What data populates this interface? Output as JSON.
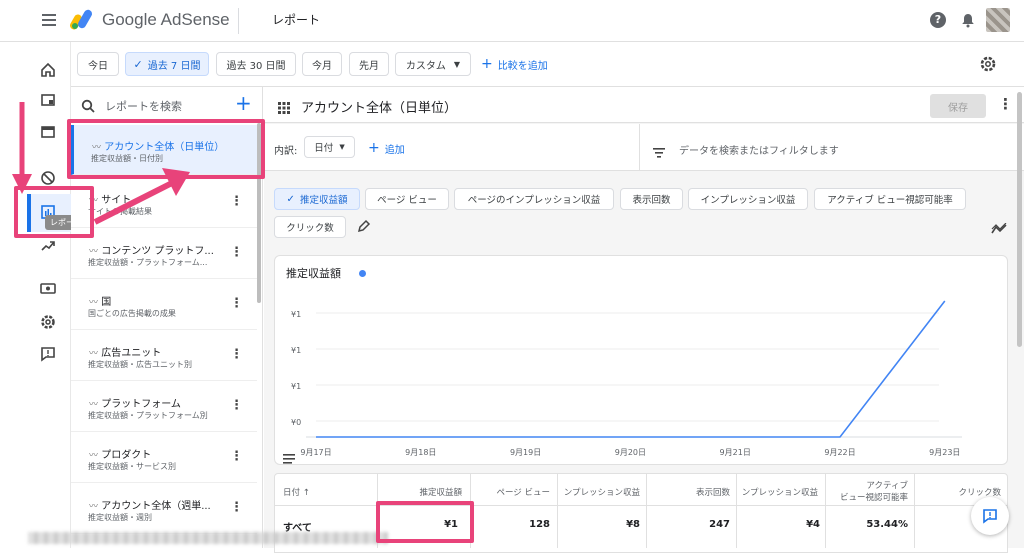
{
  "header": {
    "app_name": "Google AdSense",
    "page_title": "レポート"
  },
  "filters": {
    "today": "今日",
    "last7": "過去 7 日間",
    "last30": "過去 30 日間",
    "this_month": "今月",
    "last_month": "先月",
    "custom": "カスタム",
    "add_compare": "比較を追加"
  },
  "rail": {
    "tooltip": "レポート"
  },
  "report_list": {
    "search_placeholder": "レポートを検索",
    "items": [
      {
        "title": "アカウント全体（日単位）",
        "sub": "推定収益額・日付別"
      },
      {
        "title": "サイト",
        "sub": "サイトの掲載結果"
      },
      {
        "title": "コンテンツ プラットフ...",
        "sub": "推定収益額・プラットフォーム..."
      },
      {
        "title": "国",
        "sub": "国ごとの広告掲載の成果"
      },
      {
        "title": "広告ユニット",
        "sub": "推定収益額・広告ユニット別"
      },
      {
        "title": "プラットフォーム",
        "sub": "推定収益額・プラットフォーム別"
      },
      {
        "title": "プロダクト",
        "sub": "推定収益額・サービス別"
      },
      {
        "title": "アカウント全体（週単...",
        "sub": "推定収益額・週別"
      }
    ]
  },
  "report": {
    "title": "アカウント全体（日単位）",
    "save": "保存",
    "breakdown_label": "内訳:",
    "breakdown_value": "日付",
    "add": "追加",
    "search_filter": "データを検索またはフィルタします",
    "metrics": [
      "推定収益額",
      "ページ ビュー",
      "ページのインプレッション収益",
      "表示回数",
      "インプレッション収益",
      "アクティブ ビュー視認可能率",
      "クリック数"
    ]
  },
  "chart_data": {
    "type": "line",
    "title": "推定収益額",
    "x": [
      "9月17日",
      "9月18日",
      "9月19日",
      "9月20日",
      "9月21日",
      "9月22日",
      "9月23日"
    ],
    "series": [
      {
        "name": "推定収益額",
        "values": [
          0,
          0,
          0,
          0,
          0,
          0,
          1
        ]
      }
    ],
    "yticks": [
      "¥1",
      "¥1",
      "¥1",
      "¥0"
    ],
    "color": "#4285f4"
  },
  "table": {
    "headers": [
      "日付 ↑",
      "推定収益額",
      "ページ ビュー",
      "ンプレッション収益",
      "表示回数",
      "ンプレッション収益",
      "アクティブビュー視認可能率",
      "クリック数"
    ],
    "header_active_line1": "アクティブ",
    "header_active_line2": "ビュー視認可能率",
    "total_row": [
      "すべて",
      "¥1",
      "128",
      "¥8",
      "247",
      "¥4",
      "53.44%",
      ""
    ]
  },
  "colors": {
    "accent": "#1a73e8",
    "highlight": "#e8437a",
    "selected_bg": "#e8f0fe"
  }
}
